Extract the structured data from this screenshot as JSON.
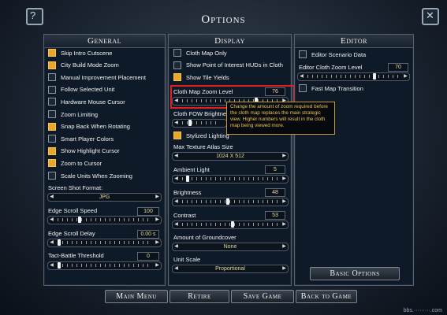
{
  "title": "Options",
  "sections": {
    "general": "General",
    "display": "Display",
    "editor": "Editor"
  },
  "general": {
    "checkboxes": [
      {
        "label": "Skip Intro Cutscene",
        "checked": true
      },
      {
        "label": "City Build Mode Zoom",
        "checked": true
      },
      {
        "label": "Manual Improvement Placement",
        "checked": false
      },
      {
        "label": "Follow Selected Unit",
        "checked": false
      },
      {
        "label": "Hardware Mouse Cursor",
        "checked": false
      },
      {
        "label": "Zoom Limiting",
        "checked": false
      },
      {
        "label": "Snap Back When Rotating",
        "checked": true
      },
      {
        "label": "Smart Player Colors",
        "checked": false
      },
      {
        "label": "Show Highlight Cursor",
        "checked": true
      },
      {
        "label": "Zoom to Cursor",
        "checked": true
      },
      {
        "label": "Scale Units When Zooming",
        "checked": false
      }
    ],
    "screenshot_format_label": "Screen Shot Format:",
    "screenshot_format_value": "JPG",
    "edge_scroll_speed_label": "Edge Scroll Speed",
    "edge_scroll_speed_value": "100",
    "edge_scroll_delay_label": "Edge Scroll Delay",
    "edge_scroll_delay_value": "0.00 s",
    "tact_battle_threshold_label": "Tact-Battle Threshold",
    "tact_battle_threshold_value": "0"
  },
  "display": {
    "checkboxes": [
      {
        "label": "Cloth Map Only",
        "checked": false
      },
      {
        "label": "Show Point of Interest HUDs in Cloth",
        "checked": false
      },
      {
        "label": "Show Tile Yields",
        "checked": true
      }
    ],
    "cloth_map_zoom_label": "Cloth Map Zoom Level",
    "cloth_map_zoom_value": "76",
    "cloth_fow_label": "Cloth FOW Brightness",
    "stylized_lighting_label": "Stylized Lighting",
    "max_texture_label": "Max Texture Atlas Size",
    "max_texture_value": "1024 X 512",
    "ambient_light_label": "Ambient Light",
    "ambient_light_value": "5",
    "brightness_label": "Brightness",
    "brightness_value": "48",
    "contrast_label": "Contrast",
    "contrast_value": "53",
    "groundcover_label": "Amount of Groundcover",
    "groundcover_value": "None",
    "unit_scale_label": "Unit Scale",
    "unit_scale_value": "Proportional",
    "tooltip": "Change the amount of zoom required before the cloth map replaces the main strategic view. Higher numbers will result in the cloth map being viewed more."
  },
  "editor": {
    "scenario_data_label": "Editor Scenario Data",
    "cloth_zoom_label": "Editor Cloth Zoom Level",
    "cloth_zoom_value": "70",
    "fast_map_transition_label": "Fast Map Transition",
    "basic_options_label": "Basic Options"
  },
  "buttons": {
    "main_menu": "Main Menu",
    "retire": "Retire",
    "save_game": "Save Game",
    "back_to_game": "Back to Game"
  },
  "corners": {
    "left": "?",
    "right": "✕"
  },
  "watermark": "bbs.·········.com"
}
